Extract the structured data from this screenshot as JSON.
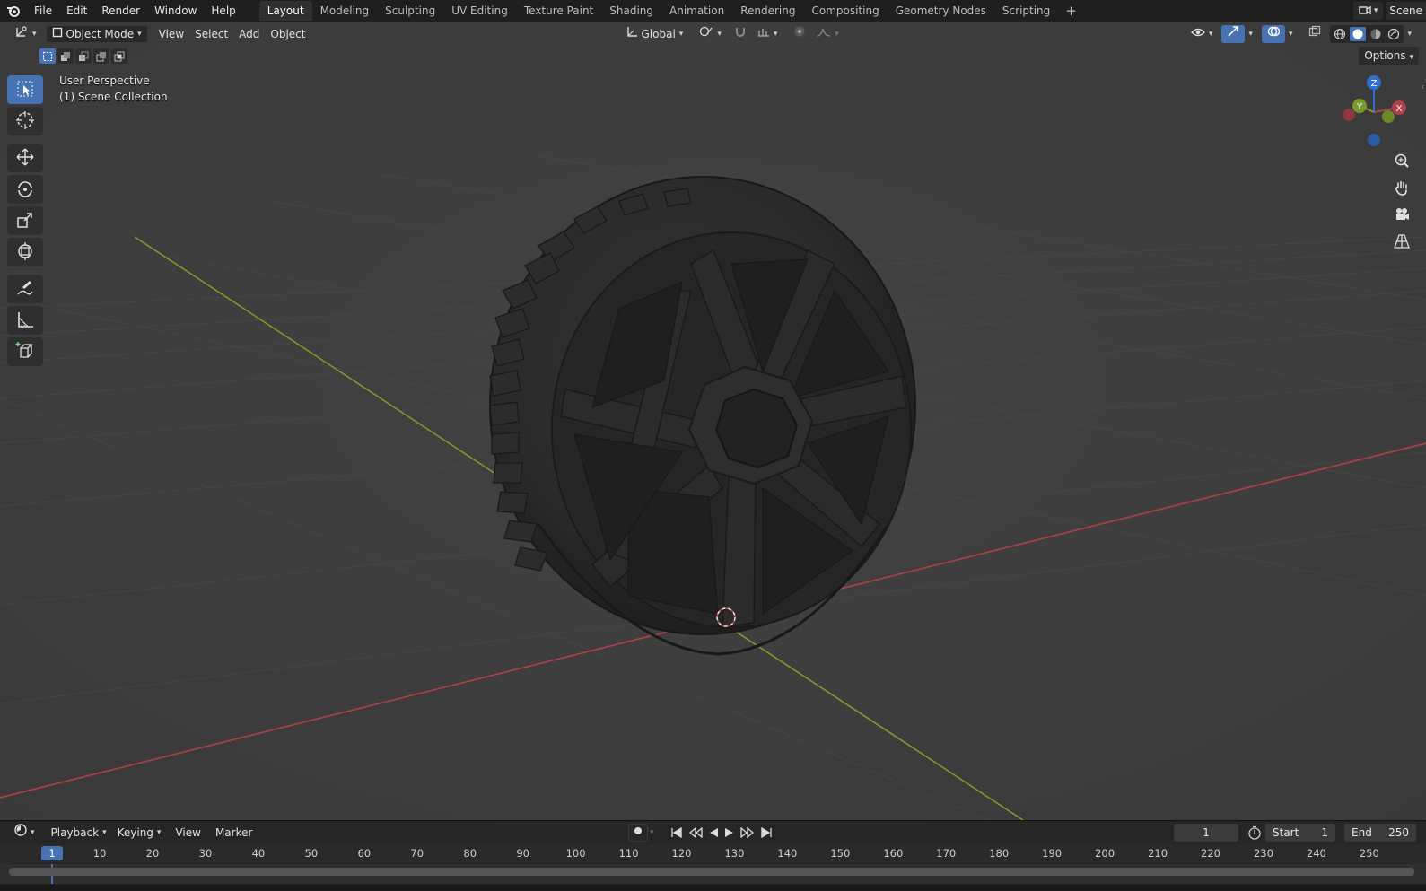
{
  "topbar": {
    "menu": [
      "File",
      "Edit",
      "Render",
      "Window",
      "Help"
    ],
    "tabs": [
      "Layout",
      "Modeling",
      "Sculpting",
      "UV Editing",
      "Texture Paint",
      "Shading",
      "Animation",
      "Rendering",
      "Compositing",
      "Geometry Nodes",
      "Scripting"
    ],
    "active_tab": "Layout",
    "add_tab": "+",
    "scene_label": "Scene"
  },
  "viewport_header": {
    "mode": "Object Mode",
    "menus": [
      "View",
      "Select",
      "Add",
      "Object"
    ],
    "orientation": "Global",
    "options": "Options"
  },
  "viewport": {
    "perspective": "User Perspective",
    "collection": "(1) Scene Collection",
    "gizmo_axes": [
      "Z",
      "Y",
      "X"
    ]
  },
  "toolbar": {
    "tools": [
      "select-box-icon",
      "cursor-icon",
      "move-icon",
      "rotate-icon",
      "scale-icon",
      "transform-icon",
      "annotate-icon",
      "measure-icon",
      "add-cube-icon"
    ]
  },
  "timeline": {
    "menus": [
      "Playback",
      "Keying",
      "View",
      "Marker"
    ],
    "current_frame": "1",
    "start_label": "Start",
    "start_value": "1",
    "end_label": "End",
    "end_value": "250",
    "ruler_badge": "1",
    "ruler_ticks": [
      "10",
      "20",
      "30",
      "40",
      "50",
      "60",
      "70",
      "80",
      "90",
      "100",
      "110",
      "120",
      "130",
      "140",
      "150",
      "160",
      "170",
      "180",
      "190",
      "200",
      "210",
      "220",
      "230",
      "240",
      "250"
    ]
  },
  "colors": {
    "accent": "#4772b3",
    "x_axis": "#b0404a",
    "y_axis": "#7a9a2c",
    "z_axis": "#2f6fd0"
  }
}
